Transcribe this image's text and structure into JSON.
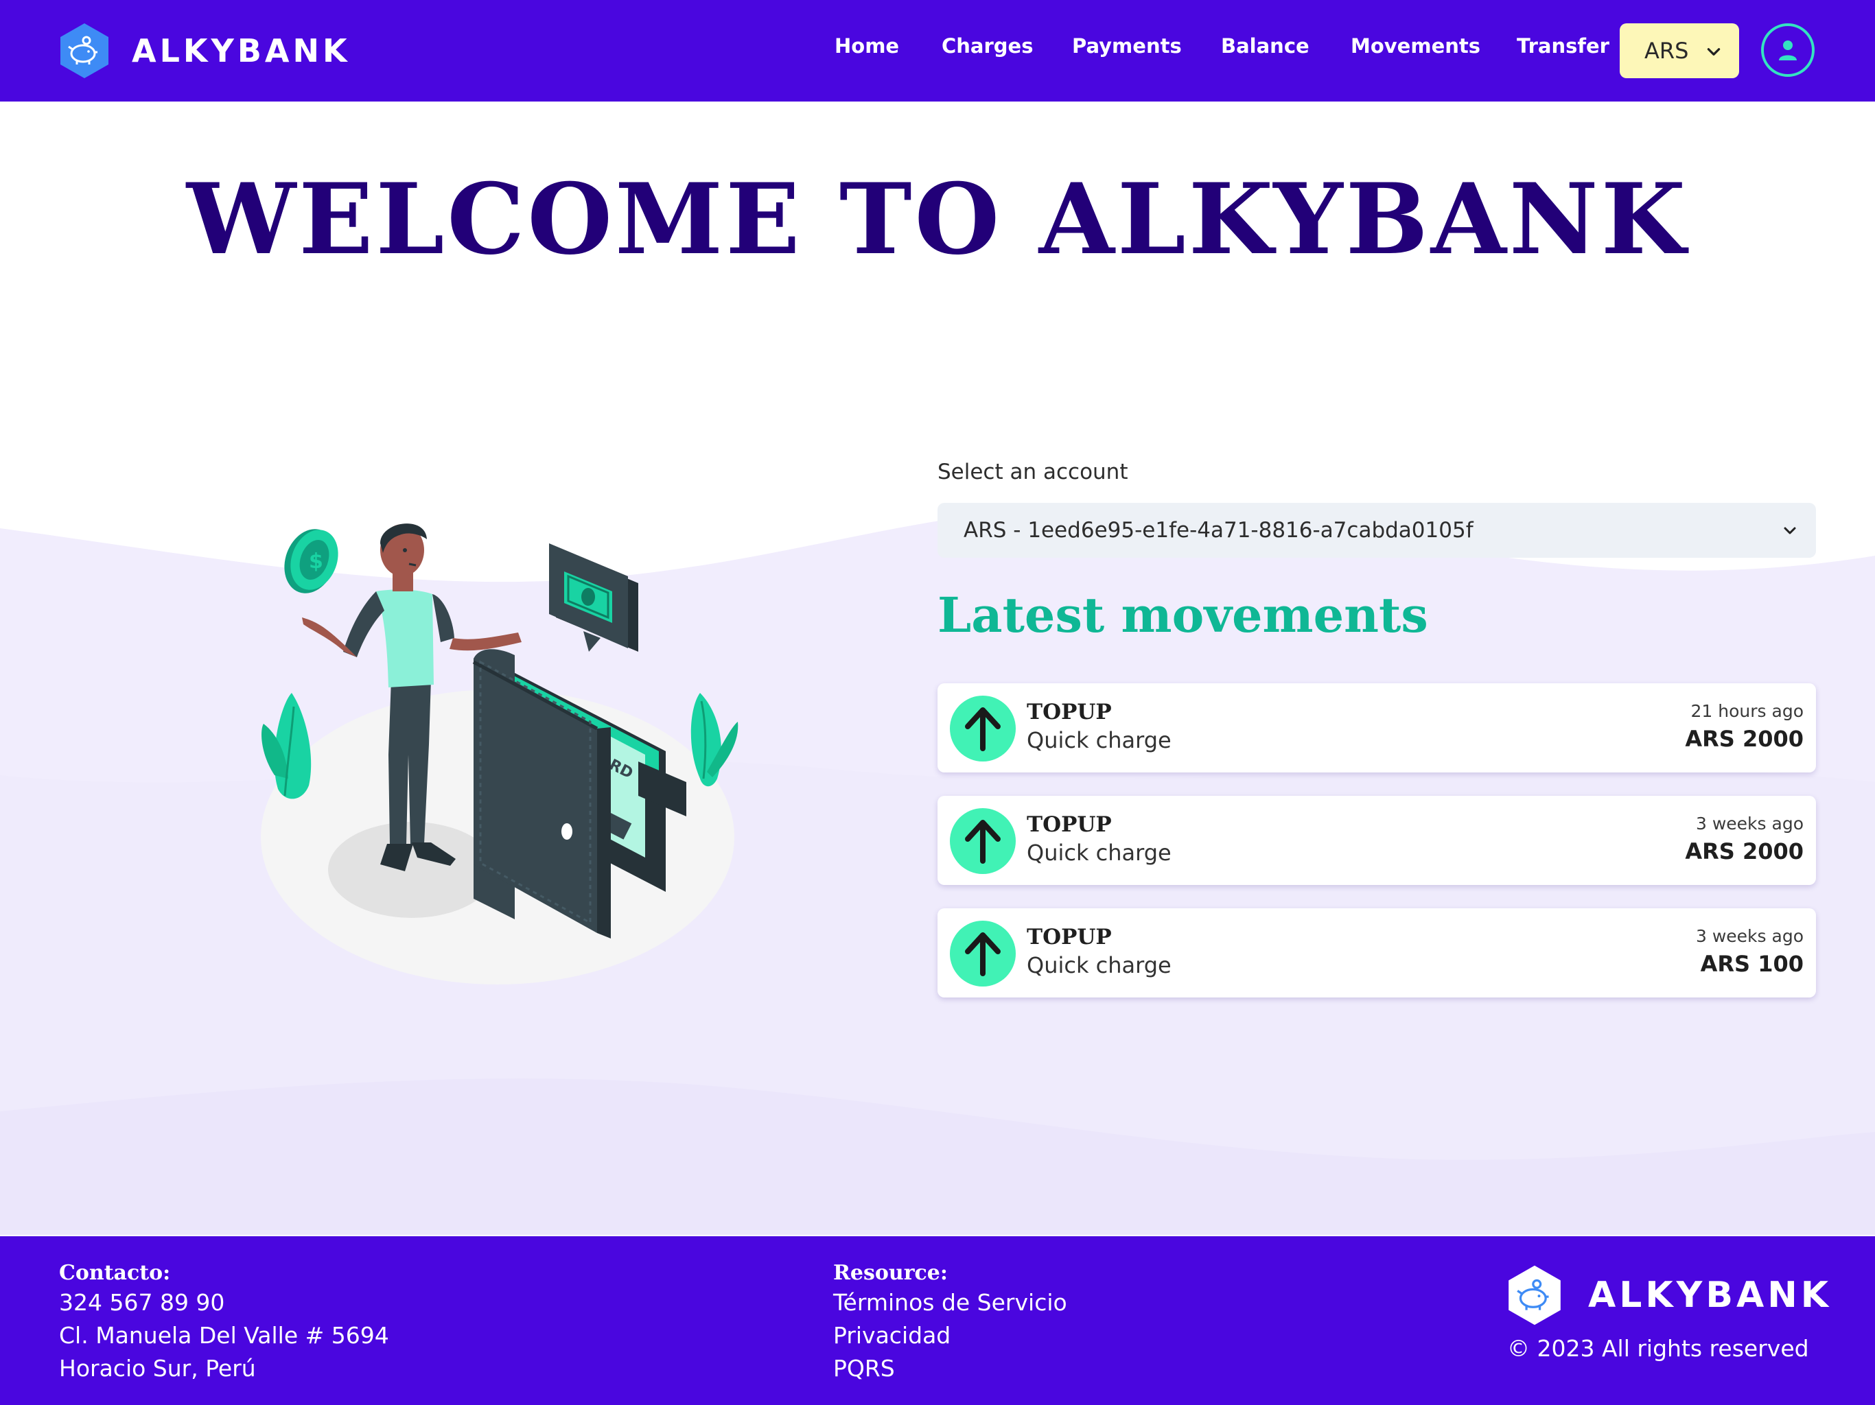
{
  "navbar": {
    "brand": "ALKYBANK",
    "links": [
      {
        "id": "home",
        "label": "Home"
      },
      {
        "id": "charges",
        "label": "Charges"
      },
      {
        "id": "payments",
        "label": "Payments"
      },
      {
        "id": "balance",
        "label": "Balance"
      },
      {
        "id": "movements",
        "label": "Movements"
      },
      {
        "id": "transfer",
        "label": "Transfer"
      }
    ],
    "currency": "ARS",
    "icons": {
      "logo": "piggy-bank-hexagon-icon",
      "currency": "chevron-down-icon",
      "user": "user-icon"
    },
    "colors": {
      "background": "#4a06df",
      "currency_bg": "#fdf7b8",
      "user_ring": "#34e3c1"
    }
  },
  "hero": {
    "title": "WELCOME TO ALKYBANK",
    "colors": {
      "title": "#220078"
    }
  },
  "account": {
    "label": "Select an account",
    "selected": "ARS - 1eed6e95-e1fe-4a71-8816-a7cabda0105f"
  },
  "movements": {
    "title": "Latest movements",
    "items": [
      {
        "type": "TOPUP",
        "description": "Quick charge",
        "time": "21 hours ago",
        "amount": "ARS 2000",
        "icon": "arrow-up-icon"
      },
      {
        "type": "TOPUP",
        "description": "Quick charge",
        "time": "3 weeks ago",
        "amount": "ARS 2000",
        "icon": "arrow-up-icon"
      },
      {
        "type": "TOPUP",
        "description": "Quick charge",
        "time": "3 weeks ago",
        "amount": "ARS 100",
        "icon": "arrow-up-icon"
      }
    ],
    "colors": {
      "title": "#0fb795",
      "icon_bg": "#41f2b5"
    }
  },
  "footer": {
    "contact": {
      "heading": "Contacto:",
      "lines": [
        "324 567 89 90",
        "Cl. Manuela Del Valle # 5694",
        "Horacio Sur, Perú"
      ]
    },
    "resources": {
      "heading": "Resource:",
      "links": [
        "Términos de Servicio",
        "Privacidad",
        "PQRS"
      ]
    },
    "brand": "ALKYBANK",
    "copyright": "© 2023 All rights reserved"
  }
}
